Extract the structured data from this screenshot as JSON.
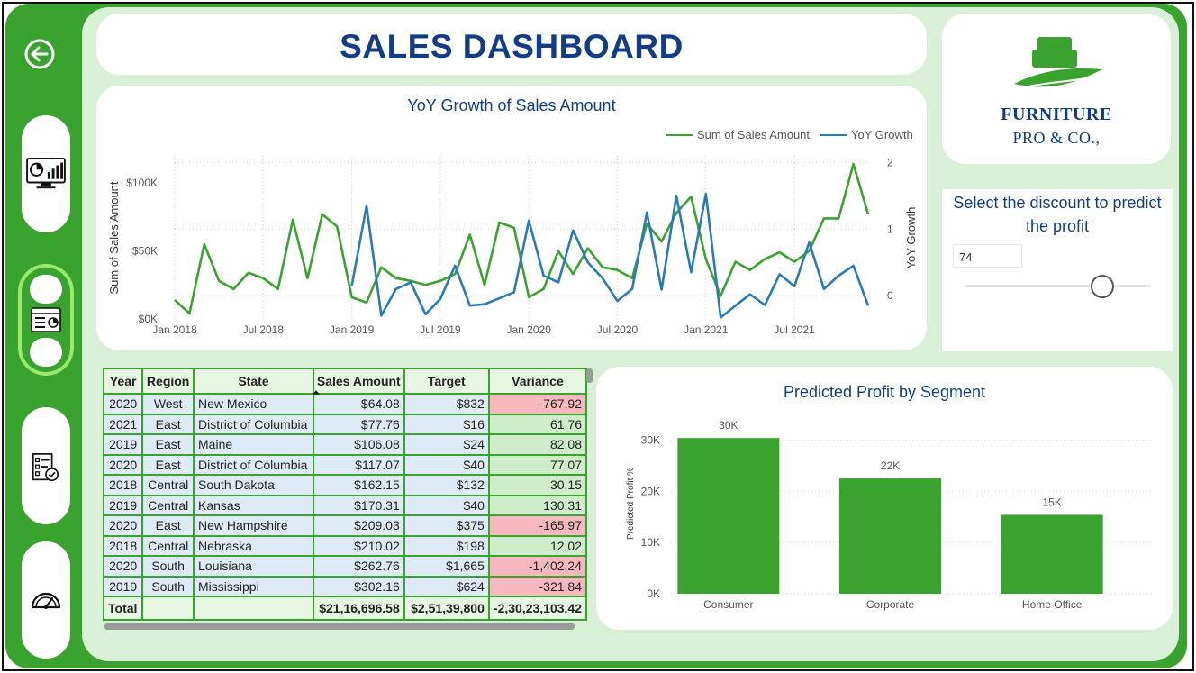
{
  "header": {
    "title": "SALES DASHBOARD"
  },
  "logo": {
    "line1": "FURNITURE",
    "line2": "PRO & CO.,",
    "brand_green": "#3aa32f",
    "brand_navy": "#123c86"
  },
  "sidebar": {
    "items": [
      {
        "icon": "arrow-left-circle-icon"
      },
      {
        "icon": "monitor-chart-icon"
      },
      {
        "icon": "dashboard-panel-icon",
        "active": true
      },
      {
        "icon": "checklist-icon"
      },
      {
        "icon": "gauge-icon"
      }
    ]
  },
  "line_chart": {
    "title": "YoY Growth of Sales Amount",
    "legend": [
      {
        "label": "Sum of Sales Amount",
        "color": "#3aa32f"
      },
      {
        "label": "YoY Growth",
        "color": "#2a7ab8"
      }
    ],
    "y_left_label": "Sum of Sales Amount",
    "y_right_label": "YoY Growth",
    "y_left_ticks": [
      "$0K",
      "$50K",
      "$100K"
    ],
    "y_right_ticks": [
      "0",
      "1",
      "2"
    ],
    "x_ticks": [
      "Jan 2018",
      "Jul 2018",
      "Jan 2019",
      "Jul 2019",
      "Jan 2020",
      "Jul 2020",
      "Jan 2021",
      "Jul 2021"
    ]
  },
  "discount": {
    "title": "Select the discount to predict the profit",
    "value": "74",
    "slider_fraction": 0.74
  },
  "table": {
    "columns": [
      "Year",
      "Region",
      "State",
      "Sales Amount",
      "Target",
      "Variance"
    ],
    "rows": [
      [
        "2020",
        "West",
        "New Mexico",
        "$64.08",
        "$832",
        "-767.92"
      ],
      [
        "2021",
        "East",
        "District of Columbia",
        "$77.76",
        "$16",
        "61.76"
      ],
      [
        "2019",
        "East",
        "Maine",
        "$106.08",
        "$24",
        "82.08"
      ],
      [
        "2020",
        "East",
        "District of Columbia",
        "$117.07",
        "$40",
        "77.07"
      ],
      [
        "2018",
        "Central",
        "South Dakota",
        "$162.15",
        "$132",
        "30.15"
      ],
      [
        "2019",
        "Central",
        "Kansas",
        "$170.31",
        "$40",
        "130.31"
      ],
      [
        "2020",
        "East",
        "New Hampshire",
        "$209.03",
        "$375",
        "-165.97"
      ],
      [
        "2018",
        "Central",
        "Nebraska",
        "$210.02",
        "$198",
        "12.02"
      ],
      [
        "2020",
        "South",
        "Louisiana",
        "$262.76",
        "$1,665",
        "-1,402.24"
      ],
      [
        "2019",
        "South",
        "Mississippi",
        "$302.16",
        "$624",
        "-321.84"
      ]
    ],
    "total": [
      "Total",
      "",
      "",
      "$21,16,696.58",
      "$2,51,39,800",
      "-2,30,23,103.42"
    ],
    "colors": {
      "negative": "#f7b8c0",
      "positive": "#cfeccb"
    }
  },
  "chart_data": [
    {
      "type": "line",
      "title": "YoY Growth of Sales Amount",
      "ylabel": "Sum of Sales Amount",
      "ylabel_right": "YoY Growth",
      "ylim": [
        0,
        120000
      ],
      "ylim_right": [
        -0.35,
        2.1
      ],
      "legend_position": "top-right",
      "grid": true,
      "x": [
        "2018-01",
        "2018-02",
        "2018-03",
        "2018-04",
        "2018-05",
        "2018-06",
        "2018-07",
        "2018-08",
        "2018-09",
        "2018-10",
        "2018-11",
        "2018-12",
        "2019-01",
        "2019-02",
        "2019-03",
        "2019-04",
        "2019-05",
        "2019-06",
        "2019-07",
        "2019-08",
        "2019-09",
        "2019-10",
        "2019-11",
        "2019-12",
        "2020-01",
        "2020-02",
        "2020-03",
        "2020-04",
        "2020-05",
        "2020-06",
        "2020-07",
        "2020-08",
        "2020-09",
        "2020-10",
        "2020-11",
        "2020-12",
        "2021-01",
        "2021-02",
        "2021-03",
        "2021-04",
        "2021-05",
        "2021-06",
        "2021-07",
        "2021-08",
        "2021-09",
        "2021-10",
        "2021-11",
        "2021-12"
      ],
      "series": [
        {
          "name": "Sum of Sales Amount",
          "color": "#3aa32f",
          "axis": "left",
          "values": [
            14000,
            4000,
            55000,
            28000,
            22000,
            34000,
            30000,
            22000,
            73000,
            30000,
            77000,
            68000,
            16000,
            12000,
            38000,
            30000,
            28000,
            25000,
            28000,
            33000,
            62000,
            25000,
            71000,
            67000,
            16000,
            22000,
            50000,
            33000,
            52000,
            38000,
            36000,
            30000,
            70000,
            57000,
            78000,
            90000,
            44000,
            17000,
            42000,
            36000,
            44000,
            49000,
            42000,
            50000,
            74000,
            74000,
            114000,
            77000
          ]
        },
        {
          "name": "YoY Growth",
          "color": "#2a7ab8",
          "axis": "right",
          "values": [
            null,
            null,
            null,
            null,
            null,
            null,
            null,
            null,
            null,
            null,
            null,
            null,
            0.15,
            1.35,
            -0.3,
            0.1,
            0.2,
            -0.28,
            -0.05,
            0.45,
            -0.15,
            -0.13,
            null,
            0.05,
            1.13,
            0.3,
            0.2,
            0.98,
            0.5,
            0.26,
            -0.08,
            0.1,
            1.25,
            0.09,
            1.5,
            0.35,
            1.53,
            -0.33,
            -0.15,
            0.02,
            -0.14,
            0.32,
            0.14,
            0.8,
            0.1,
            0.3,
            0.45,
            -0.15
          ]
        }
      ]
    },
    {
      "type": "bar",
      "title": "Predicted Profit by Segment",
      "ylabel": "Predicted Profit %",
      "categories": [
        "Consumer",
        "Corporate",
        "Home Office"
      ],
      "values": [
        30400,
        22500,
        15400
      ],
      "data_labels": [
        "30K",
        "22K",
        "15K"
      ],
      "y_ticks": [
        "0K",
        "10K",
        "20K",
        "30K"
      ],
      "ylim": [
        0,
        35000
      ],
      "color": "#3aa32f",
      "grid": true
    }
  ]
}
